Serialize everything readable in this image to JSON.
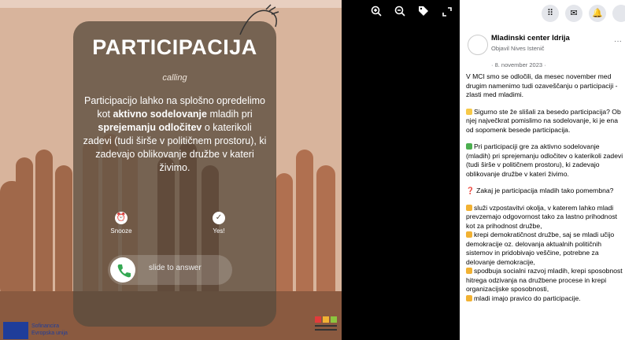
{
  "image": {
    "title": "PARTICIPACIJA",
    "subtitle": "calling",
    "body_1": "Participacijo lahko na splošno opredelimo kot ",
    "body_bold_1": "aktivno sodelovanje",
    "body_2": " mladih pri ",
    "body_bold_2": "sprejemanju odločitev",
    "body_3": " o katerikoli zadevi (tudi širše v političnem prostoru), ki zadevajo oblikovanje družbe v kateri živimo.",
    "snooze_label": "Snooze",
    "yes_label": "Yes!",
    "slide_label": "slide to answer",
    "eu_text": "Sofinancira Evropska unija",
    "logo_text": "MLADINSKI CENTER IDRIJA"
  },
  "viewer_toolbar": {
    "zoom_in_icon": "zoom-in-icon",
    "zoom_out_icon": "zoom-out-icon",
    "tag_icon": "tag-icon",
    "fullscreen_icon": "fullscreen-icon"
  },
  "fb_header": {
    "icons": [
      "grid-menu-icon",
      "messenger-icon",
      "bell-icon",
      "profile-icon"
    ]
  },
  "post": {
    "page_name": "Mladinski center Idrija",
    "posted_by": "Objavil Nives Istenič",
    "date": "· 8. november 2023 ·",
    "more": "···",
    "paragraphs": [
      "V MCI smo se odločili, da mesec november med drugim namenimo tudi ozaveščanju o participaciji - zlasti med mladimi.",
      "Sigurno ste že slišali za besedo participacija? Ob njej največkrat pomislimo na sodelovanje, ki je ena od sopomenk besede participacija.",
      "Pri participaciji gre za aktivno sodelovanje (mladih) pri sprejemanju odločitev o katerikoli zadevi (tudi širše v političnem prostoru), ki zadevajo oblikovanje družbe v kateri živimo.",
      "Zakaj je participacija mladih tako pomembna?"
    ],
    "bullets": [
      "služi vzpostavitvi okolja, v katerem lahko mladi prevzemajo odgovornost tako za lastno prihodnost kot za prihodnost družbe,",
      "krepi demokratičnost družbe, saj se mladi učijo demokracije oz. delovanja aktualnih političnih sistemov in pridobivajo veščine, potrebne za delovanje demokracije,",
      "spodbuja socialni razvoj mladih, krepi sposobnost hitrega odzivanja na družbene procese in krepi organizacijske sposobnosti,",
      "mladi imajo pravico do participacije."
    ]
  }
}
